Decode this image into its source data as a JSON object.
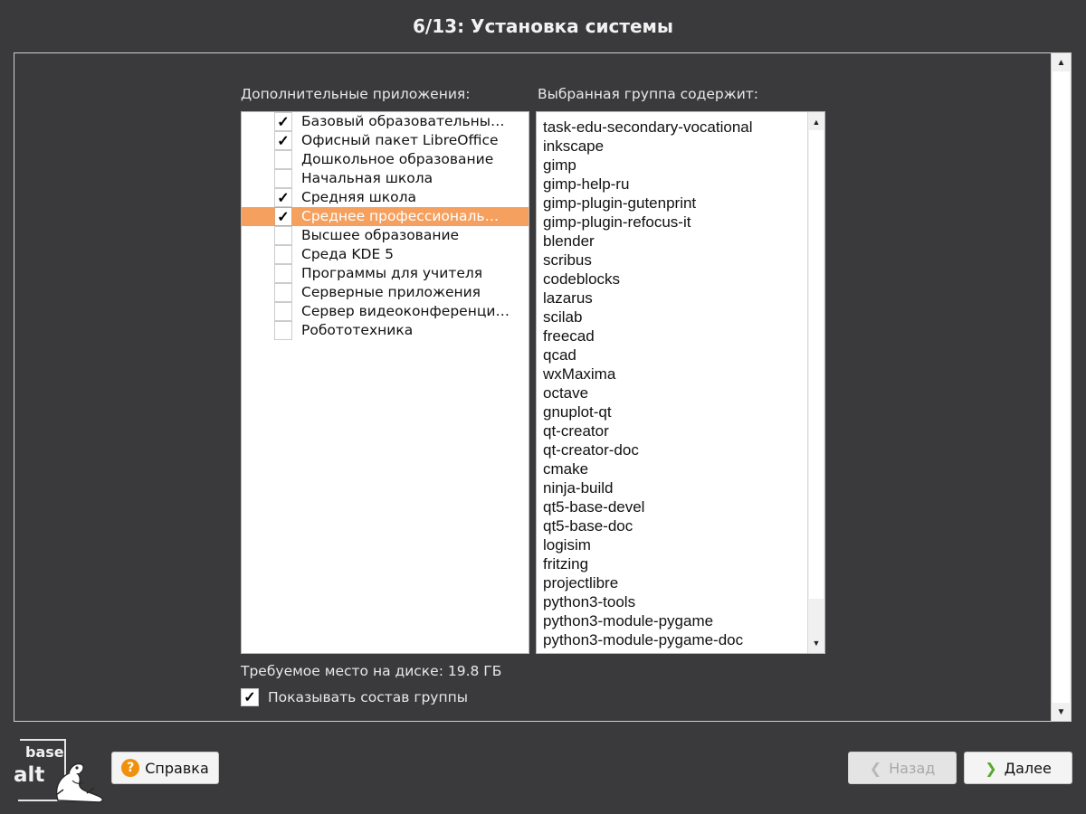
{
  "window": {
    "title": "6/13: Установка системы"
  },
  "labels": {
    "additional_apps": "Дополнительные приложения:",
    "group_contains": "Выбранная группа содержит:",
    "disk_space": "Требуемое место на диске: 19.8 ГБ",
    "show_group": "Показывать состав группы"
  },
  "groups": [
    {
      "label": "Базовый образовательны…",
      "checked": true,
      "selected": false
    },
    {
      "label": "Офисный пакет LibreOffice",
      "checked": true,
      "selected": false
    },
    {
      "label": "Дошкольное образование",
      "checked": false,
      "selected": false
    },
    {
      "label": "Начальная школа",
      "checked": false,
      "selected": false
    },
    {
      "label": "Средняя школа",
      "checked": true,
      "selected": false
    },
    {
      "label": "Среднее профессиональ…",
      "checked": true,
      "selected": true
    },
    {
      "label": "Высшее образование",
      "checked": false,
      "selected": false
    },
    {
      "label": "Среда KDE 5",
      "checked": false,
      "selected": false
    },
    {
      "label": "Программы для учителя",
      "checked": false,
      "selected": false
    },
    {
      "label": "Серверные приложения",
      "checked": false,
      "selected": false
    },
    {
      "label": "Сервер видеоконференци…",
      "checked": false,
      "selected": false
    },
    {
      "label": "Робототехника",
      "checked": false,
      "selected": false
    }
  ],
  "packages": [
    "task-edu-secondary-vocational",
    "inkscape",
    "gimp",
    "gimp-help-ru",
    "gimp-plugin-gutenprint",
    "gimp-plugin-refocus-it",
    "blender",
    "scribus",
    "codeblocks",
    "lazarus",
    "scilab",
    "freecad",
    "qcad",
    "wxMaxima",
    "octave",
    "gnuplot-qt",
    "qt-creator",
    "qt-creator-doc",
    "cmake",
    "ninja-build",
    "qt5-base-devel",
    "qt5-base-doc",
    "logisim",
    "fritzing",
    "projectlibre",
    "python3-tools",
    "python3-module-pygame",
    "python3-module-pygame-doc"
  ],
  "show_group_checked": true,
  "logo": {
    "line1": "base",
    "line2": "alt"
  },
  "buttons": {
    "help": "Справка",
    "back": "Назад",
    "next": "Далее",
    "back_enabled": false
  },
  "glyphs": {
    "check": "✓",
    "help": "?",
    "chevron_left": "❮",
    "chevron_right": "❯",
    "arrow_up": "▲",
    "arrow_down": "▼"
  },
  "colors": {
    "background": "#3a3a3c",
    "selection": "#f5a05e",
    "help_icon": "#f0900c",
    "next_chevron": "#5aa82c"
  }
}
